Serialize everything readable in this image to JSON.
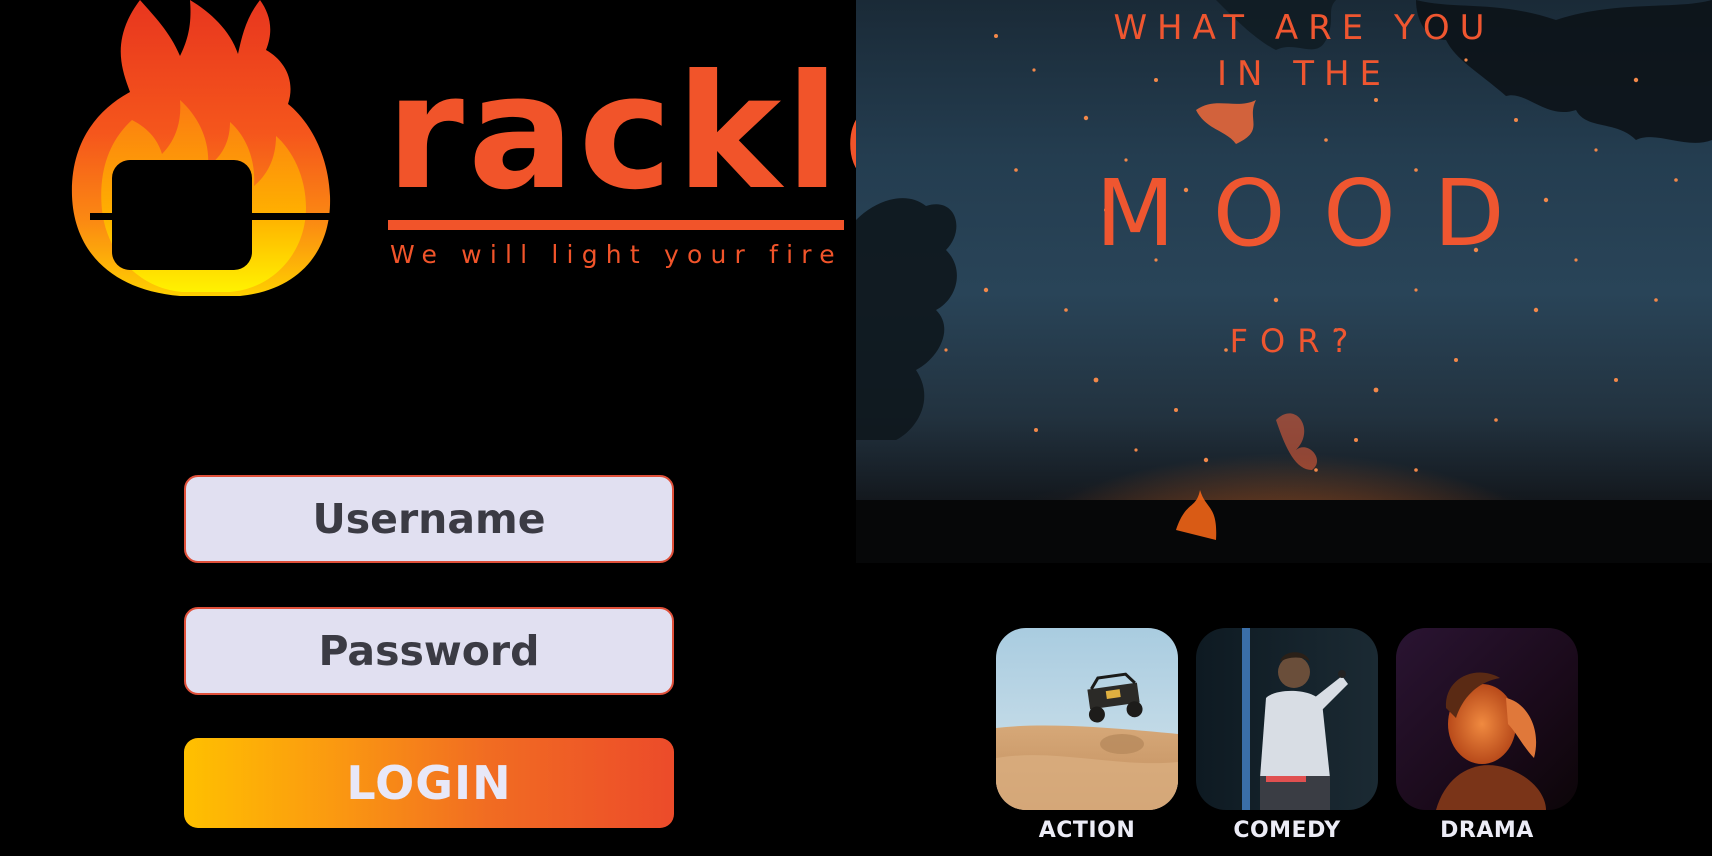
{
  "brand": {
    "word": "rackle",
    "tagline": "We will light your fire"
  },
  "login": {
    "username_placeholder": "Username",
    "password_placeholder": "Password",
    "login_label": "LOGIN"
  },
  "hero": {
    "line1": "WHAT ARE YOU",
    "line2": "IN THE",
    "line3": "MOOD",
    "line4": "FOR?"
  },
  "genres": [
    {
      "label": "ACTION",
      "image": "dune-buggy-jumping-desert"
    },
    {
      "label": "COMEDY",
      "image": "comedian-with-microphone"
    },
    {
      "label": "DRAMA",
      "image": "woman-in-orange-light"
    }
  ],
  "colors": {
    "background": "#000000",
    "accent": "#f1542a",
    "input_background": "#e1e0f1",
    "input_border": "#e0503a",
    "button_gradient_start": "#ffc000",
    "button_gradient_end": "#ec4b2a",
    "label_text": "#ececf6"
  },
  "icons": {
    "logo": "flame-marshmallow-icon"
  }
}
